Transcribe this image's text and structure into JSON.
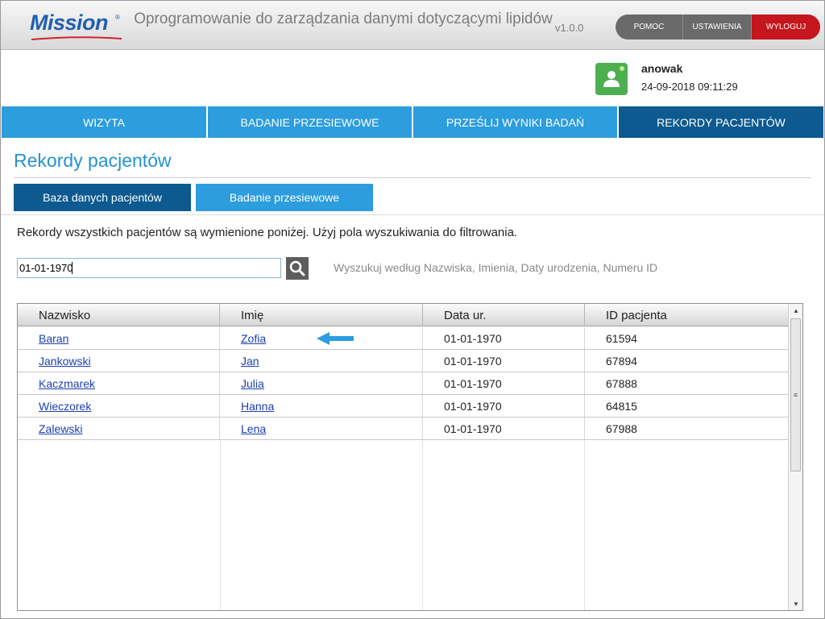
{
  "header": {
    "logo_text": "Mission",
    "logo_mark": "®",
    "app_title": "Oprogramowanie do zarządzania danymi dotyczącymi lipidów",
    "version": "v1.0.0",
    "buttons": {
      "help": "POMOC",
      "settings": "USTAWIENIA",
      "logout": "WYLOGUJ"
    },
    "colors": {
      "logo": "#1f5fae",
      "logout": "#c4161c"
    }
  },
  "user": {
    "avatar_icon": "user-icon",
    "username": "anowak",
    "datetime": "24-09-2018 09:11:29"
  },
  "nav": {
    "tabs": [
      {
        "label": "WIZYTA"
      },
      {
        "label": "BADANIE PRZESIEWOWE"
      },
      {
        "label": "PRZEŚLIJ WYNIKI BADAŃ"
      },
      {
        "label": "REKORDY PACJENTÓW"
      }
    ],
    "active_index": 3
  },
  "page": {
    "title": "Rekordy pacjentów",
    "subtabs": [
      {
        "label": "Baza danych pacjentów"
      },
      {
        "label": "Badanie przesiewowe"
      }
    ],
    "description": "Rekordy wszystkich pacjentów są wymienione poniżej. Użyj pola wyszukiwania do filtrowania."
  },
  "search": {
    "value": "01-01-1970",
    "button_icon": "search-icon",
    "hint": "Wyszukuj według Nazwiska, Imienia, Daty urodzenia, Numeru ID"
  },
  "table": {
    "columns": [
      "Nazwisko",
      "Imię",
      "Data ur.",
      "ID pacjenta"
    ],
    "rows": [
      {
        "last_name": "Baran",
        "first_name": "Zofia",
        "dob": "01-01-1970",
        "id": "61594"
      },
      {
        "last_name": "Jankowski",
        "first_name": "Jan",
        "dob": "01-01-1970",
        "id": "67894"
      },
      {
        "last_name": "Kaczmarek",
        "first_name": "Julia",
        "dob": "01-01-1970",
        "id": "67888"
      },
      {
        "last_name": "Wieczorek",
        "first_name": "Hanna",
        "dob": "01-01-1970",
        "id": "64815"
      },
      {
        "last_name": "Zalewski",
        "first_name": "Lena",
        "dob": "01-01-1970",
        "id": "67988"
      }
    ],
    "highlight_icon": "arrow-left-icon",
    "accent_color": "#2c9ddd"
  }
}
